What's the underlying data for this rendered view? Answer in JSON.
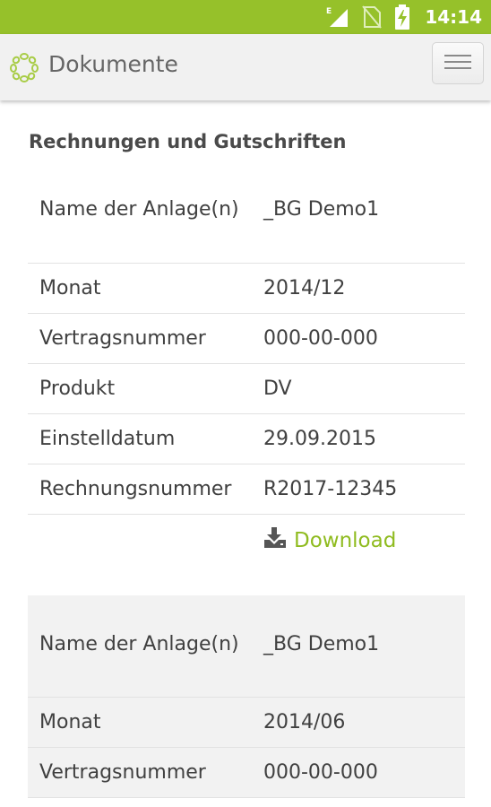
{
  "status_bar": {
    "network_label": "E",
    "time": "14:14"
  },
  "app_bar": {
    "title": "Dokumente"
  },
  "section": {
    "title": "Rechnungen und Gutschriften"
  },
  "documents": [
    {
      "rows": [
        {
          "label": "Name der Anlage(n)",
          "value": "_BG Demo1"
        },
        {
          "label": "Monat",
          "value": "2014/12"
        },
        {
          "label": "Vertragsnummer",
          "value": "000-00-000"
        },
        {
          "label": "Produkt",
          "value": "DV"
        },
        {
          "label": "Einstelldatum",
          "value": "29.09.2015"
        },
        {
          "label": "Rechnungsnummer",
          "value": "R2017-12345"
        }
      ],
      "download_label": "Download"
    },
    {
      "rows": [
        {
          "label": "Name der Anlage(n)",
          "value": "_BG Demo1"
        },
        {
          "label": "Monat",
          "value": "2014/06"
        },
        {
          "label": "Vertragsnummer",
          "value": "000-00-000"
        }
      ]
    }
  ],
  "colors": {
    "status_bar": "#96c12a",
    "accent": "#8fbb1f",
    "app_bar": "#f1f1f1",
    "alt_card": "#f2f2f2"
  },
  "icons": {
    "logo": "leaf-ring-logo-icon",
    "menu": "hamburger-menu-icon",
    "download": "download-tray-icon",
    "signal": "signal-icon",
    "sim": "no-sim-icon",
    "battery": "battery-charging-icon"
  }
}
